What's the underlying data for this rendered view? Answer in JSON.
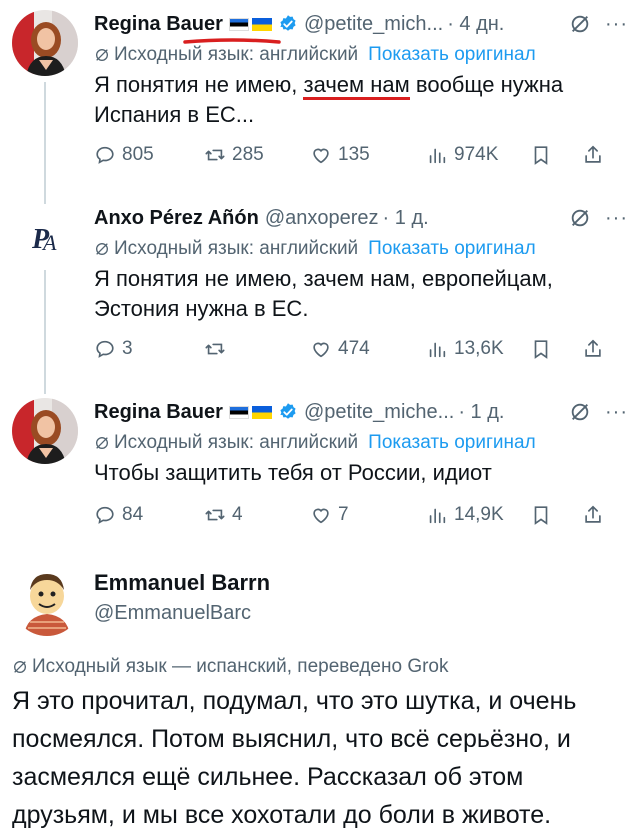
{
  "tweets": [
    {
      "name": "Regina Bauer",
      "handle": "@petite_mich...",
      "time": "· 4 дн.",
      "translate_label": "Исходный язык: английский",
      "show_original": "Показать оригинал",
      "text_before": "Я понятия не имею, ",
      "text_underline": "зачем нам",
      "text_after": " вообще нужна Испания в ЕС...",
      "replies": "805",
      "reposts": "285",
      "likes": "135",
      "views": "974K"
    },
    {
      "name": "Anxo Pérez Añón",
      "handle": "@anxoperez",
      "time": "· 1 д.",
      "translate_label": "Исходный язык: английский",
      "show_original": "Показать оригинал",
      "text": "Я понятия не имею, зачем нам, европейцам, Эстония нужна в ЕС.",
      "replies": "3",
      "reposts": "",
      "likes": "474",
      "views": "13,6K"
    },
    {
      "name": "Regina Bauer",
      "handle": "@petite_miche...",
      "time": "· 1 д.",
      "translate_label": "Исходный язык: английский",
      "show_original": "Показать оригинал",
      "text": "Чтобы защитить тебя от России, идиот",
      "replies": "84",
      "reposts": "4",
      "likes": "7",
      "views": "14,9K"
    }
  ],
  "main": {
    "name": "Emmanuel Barrn",
    "handle": "@EmmanuelBarc",
    "translate_label": "Исходный язык — испанский, переведено Grok",
    "text": "Я это прочитал, подумал, что это шутка, и очень посмеялся. Потом выяснил, что всё серьёзно, и засмеялся ещё сильнее. Рассказал об этом друзьям, и мы все хохотали до боли в животе."
  },
  "icons": {
    "reply": "reply-icon",
    "repost": "repost-icon",
    "like": "like-icon",
    "views": "views-icon",
    "bookmark": "bookmark-icon",
    "share": "share-icon",
    "grok": "grok-icon",
    "verified": "verified-badge-icon",
    "more": "more-icon"
  },
  "colors": {
    "link": "#1d9bf0",
    "muted": "#536471",
    "text": "#0f1419",
    "underline": "#d91f1f",
    "verified": "#1d9bf0"
  }
}
